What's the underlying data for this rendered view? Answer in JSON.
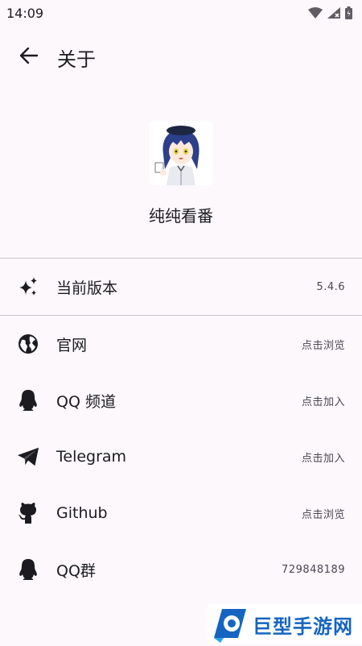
{
  "status_bar": {
    "time": "14:09"
  },
  "app_bar": {
    "title": "关于"
  },
  "header": {
    "app_name": "纯纯看番"
  },
  "version": {
    "label": "当前版本",
    "value": "5.4.6"
  },
  "items": [
    {
      "label": "官网",
      "value": "点击浏览",
      "icon": "globe-icon"
    },
    {
      "label": "QQ 频道",
      "value": "点击加入",
      "icon": "qq-icon"
    },
    {
      "label": "Telegram",
      "value": "点击加入",
      "icon": "telegram-icon"
    },
    {
      "label": "Github",
      "value": "点击浏览",
      "icon": "github-icon"
    },
    {
      "label": "QQ群",
      "value": "729848189",
      "icon": "qq-icon"
    }
  ],
  "watermark": {
    "text": "巨型手游网"
  }
}
